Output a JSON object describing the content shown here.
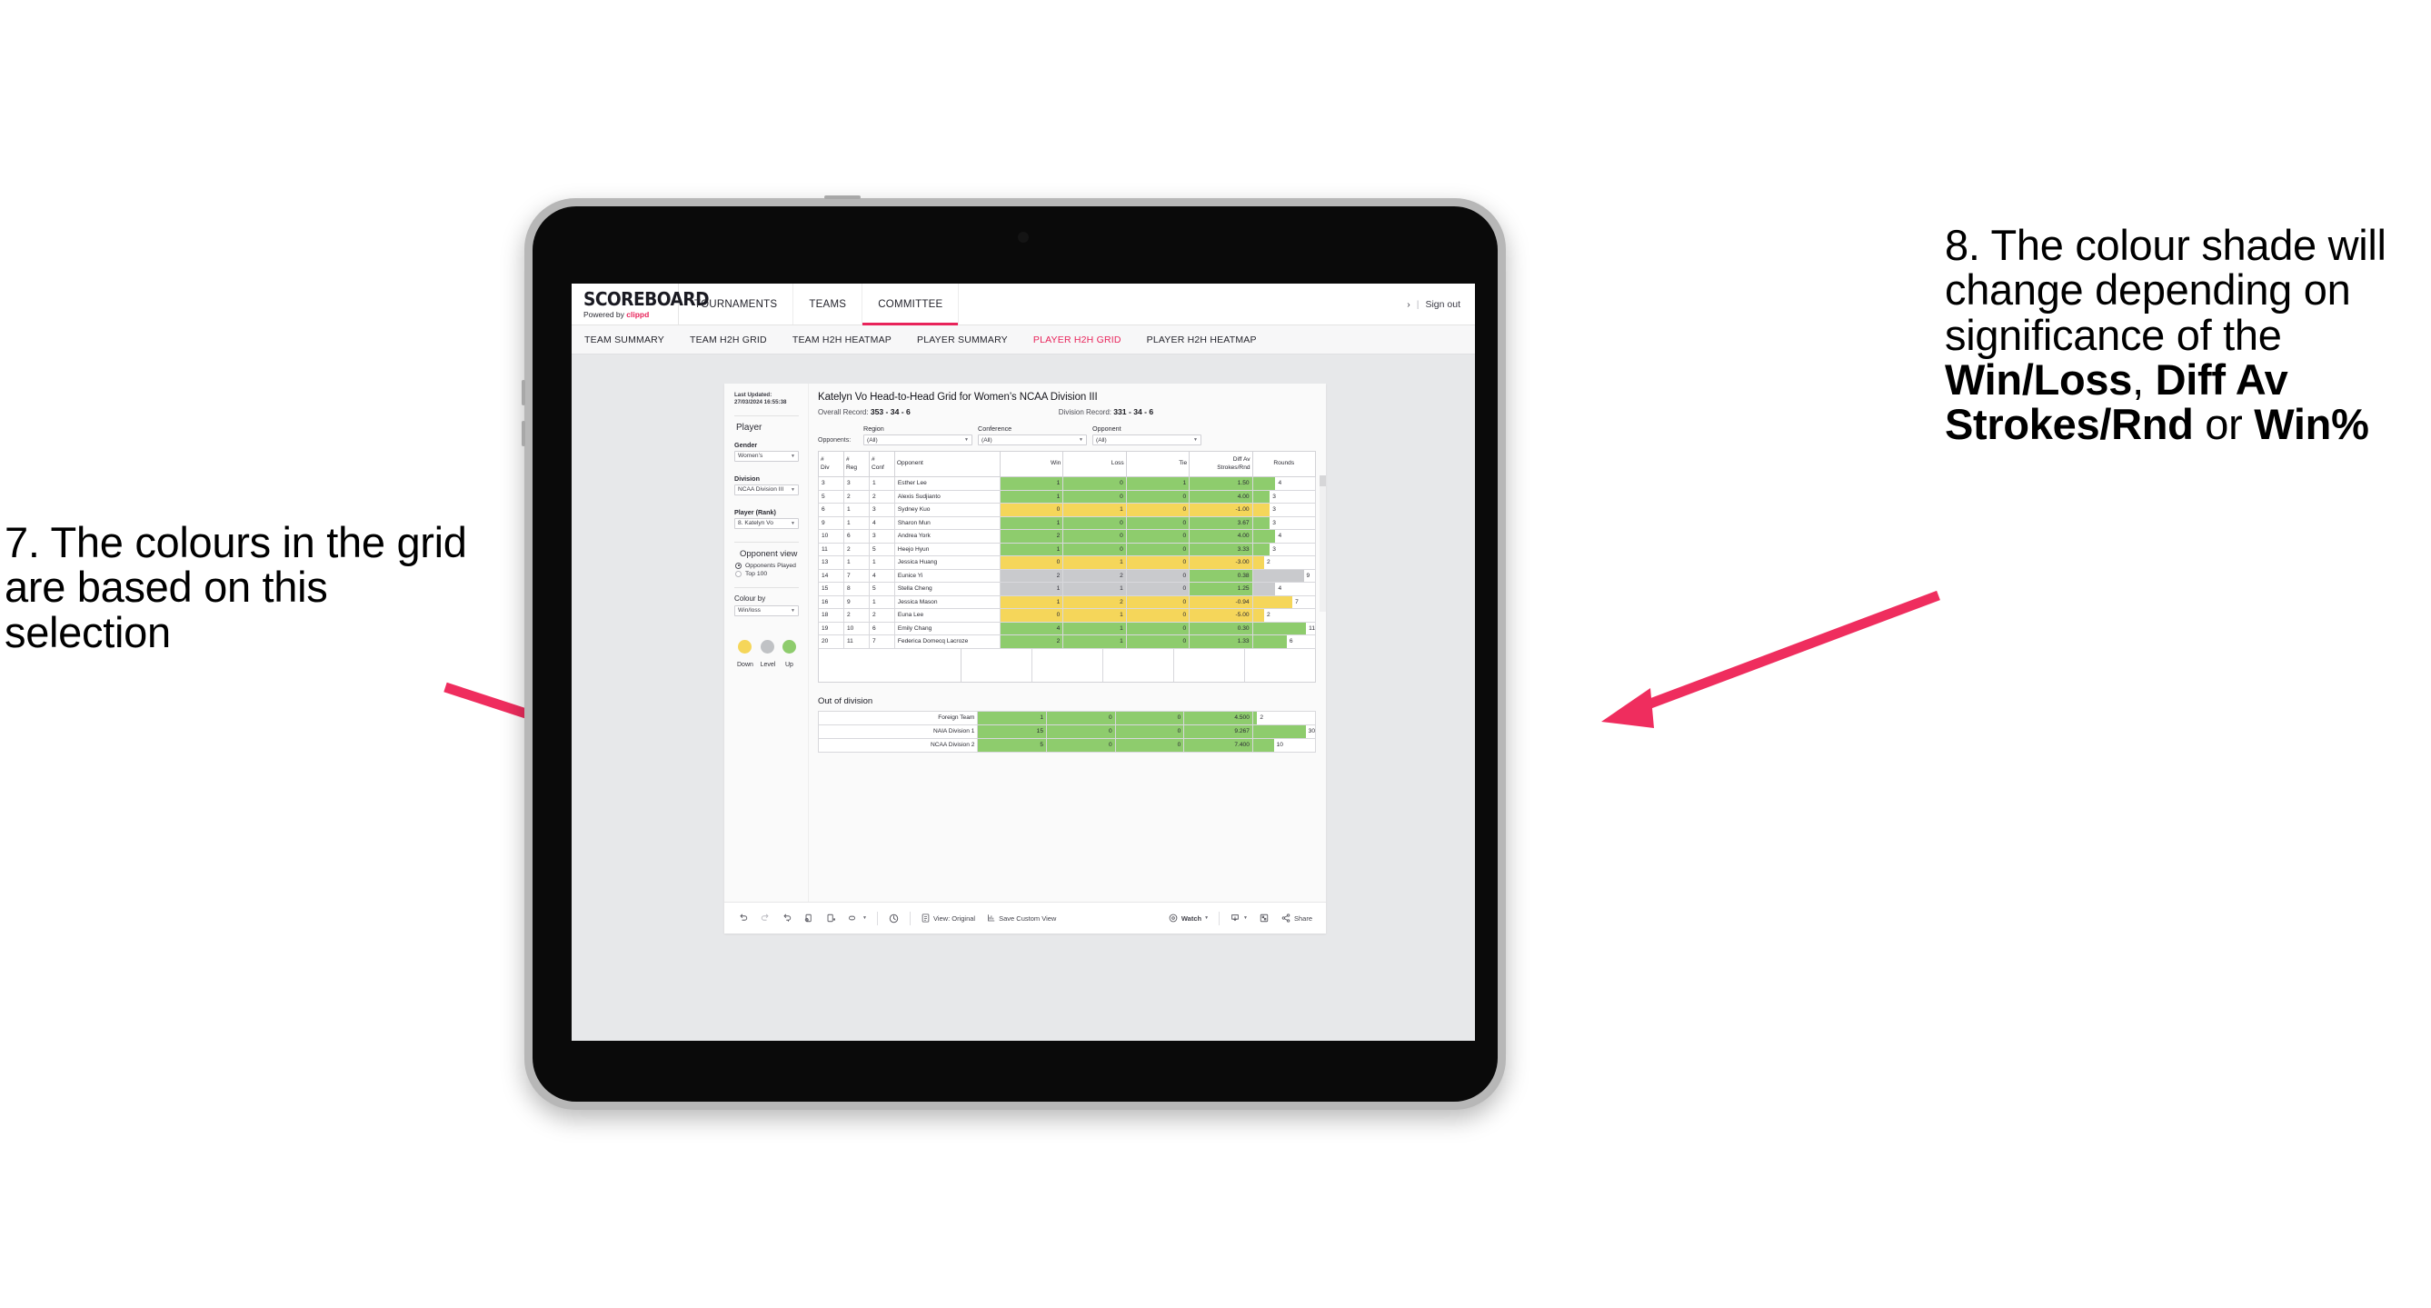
{
  "annotations": {
    "left": "7. The colours in the grid are based on this selection",
    "right_parts": [
      {
        "t": "8. The colour shade will change depending on significance of the ",
        "b": false
      },
      {
        "t": "Win/Loss",
        "b": true
      },
      {
        "t": ", ",
        "b": false
      },
      {
        "t": "Diff Av Strokes/Rnd",
        "b": true
      },
      {
        "t": " or ",
        "b": false
      },
      {
        "t": "Win%",
        "b": true
      }
    ],
    "arrow_color": "#ef2d5e"
  },
  "app": {
    "logo_main": "SCOREBOARD",
    "logo_sub_prefix": "Powered by ",
    "logo_sub_brand": "clippd",
    "top_nav": [
      {
        "label": "TOURNAMENTS",
        "active": false
      },
      {
        "label": "TEAMS",
        "active": false
      },
      {
        "label": "COMMITTEE",
        "active": true
      }
    ],
    "header_right": {
      "chevron": "›",
      "separator": "|",
      "sign_out": "Sign out"
    },
    "sub_nav": [
      {
        "label": "TEAM SUMMARY",
        "active": false
      },
      {
        "label": "TEAM H2H GRID",
        "active": false
      },
      {
        "label": "TEAM H2H HEATMAP",
        "active": false
      },
      {
        "label": "PLAYER SUMMARY",
        "active": false
      },
      {
        "label": "PLAYER H2H GRID",
        "active": true
      },
      {
        "label": "PLAYER H2H HEATMAP",
        "active": false
      }
    ],
    "accent": "#e8235a"
  },
  "sidebar": {
    "last_updated": "Last Updated: 27/03/2024 16:55:38",
    "heading": "Player",
    "fields": [
      {
        "label": "Gender",
        "value": "Women’s"
      },
      {
        "label": "Division",
        "value": "NCAA Division III"
      },
      {
        "label": "Player (Rank)",
        "value": "8. Katelyn Vo"
      }
    ],
    "opponent_view": {
      "heading": "Opponent view",
      "options": [
        {
          "label": "Opponents Played",
          "selected": true
        },
        {
          "label": "Top 100",
          "selected": false
        }
      ]
    },
    "colour_by": {
      "label": "Colour by",
      "value": "Win/loss"
    },
    "legend": [
      {
        "label": "Down",
        "color": "#f5d65a"
      },
      {
        "label": "Level",
        "color": "#c0c2c5"
      },
      {
        "label": "Up",
        "color": "#8ecc6d"
      }
    ]
  },
  "viz": {
    "title": "Katelyn Vo Head-to-Head Grid for Women’s NCAA Division III",
    "overall_record_label": "Overall Record:",
    "overall_record_value": "353 - 34 - 6",
    "division_record_label": "Division Record:",
    "division_record_value": "331 - 34 - 6",
    "opponents_label": "Opponents:",
    "filters": [
      {
        "label": "Region",
        "value": "(All)"
      },
      {
        "label": "Conference",
        "value": "(All)"
      },
      {
        "label": "Opponent",
        "value": "(All)"
      }
    ],
    "out_of_division_title": "Out of division"
  },
  "chart_data": {
    "type": "table",
    "title": "Katelyn Vo Head-to-Head Grid for Women’s NCAA Division III",
    "columns": [
      "# Div",
      "# Reg",
      "# Conf",
      "Opponent",
      "Win",
      "Loss",
      "Tie",
      "Diff Av Strokes/Rnd",
      "Rounds"
    ],
    "column_headers_multiline": [
      [
        "#",
        "Div"
      ],
      [
        "#",
        "Reg"
      ],
      [
        "#",
        "Conf"
      ],
      [
        "Opponent"
      ],
      [
        "Win"
      ],
      [
        "Loss"
      ],
      [
        "Tie"
      ],
      [
        "Diff Av",
        "Strokes/Rnd"
      ],
      [
        "Rounds"
      ]
    ],
    "rounds_max": 11,
    "rows": [
      {
        "div": "3",
        "reg": "3",
        "conf": "1",
        "opponent": "Esther Lee",
        "win": "1",
        "loss": "0",
        "tie": "1",
        "diff": "1.50",
        "rounds": 4,
        "shade": "up"
      },
      {
        "div": "5",
        "reg": "2",
        "conf": "2",
        "opponent": "Alexis Sudjianto",
        "win": "1",
        "loss": "0",
        "tie": "0",
        "diff": "4.00",
        "rounds": 3,
        "shade": "up"
      },
      {
        "div": "6",
        "reg": "1",
        "conf": "3",
        "opponent": "Sydney Kuo",
        "win": "0",
        "loss": "1",
        "tie": "0",
        "diff": "-1.00",
        "rounds": 3,
        "shade": "down"
      },
      {
        "div": "9",
        "reg": "1",
        "conf": "4",
        "opponent": "Sharon Mun",
        "win": "1",
        "loss": "0",
        "tie": "0",
        "diff": "3.67",
        "rounds": 3,
        "shade": "up"
      },
      {
        "div": "10",
        "reg": "6",
        "conf": "3",
        "opponent": "Andrea York",
        "win": "2",
        "loss": "0",
        "tie": "0",
        "diff": "4.00",
        "rounds": 4,
        "shade": "up"
      },
      {
        "div": "11",
        "reg": "2",
        "conf": "5",
        "opponent": "Heejo Hyun",
        "win": "1",
        "loss": "0",
        "tie": "0",
        "diff": "3.33",
        "rounds": 3,
        "shade": "up"
      },
      {
        "div": "13",
        "reg": "1",
        "conf": "1",
        "opponent": "Jessica Huang",
        "win": "0",
        "loss": "1",
        "tie": "0",
        "diff": "-3.00",
        "rounds": 2,
        "shade": "down"
      },
      {
        "div": "14",
        "reg": "7",
        "conf": "4",
        "opponent": "Eunice Yi",
        "win": "2",
        "loss": "2",
        "tie": "0",
        "diff": "0.38",
        "rounds": 9,
        "shade": "level",
        "diff_shade": "up"
      },
      {
        "div": "15",
        "reg": "8",
        "conf": "5",
        "opponent": "Stella Cheng",
        "win": "1",
        "loss": "1",
        "tie": "0",
        "diff": "1.25",
        "rounds": 4,
        "shade": "level",
        "diff_shade": "up"
      },
      {
        "div": "16",
        "reg": "9",
        "conf": "1",
        "opponent": "Jessica Mason",
        "win": "1",
        "loss": "2",
        "tie": "0",
        "diff": "-0.94",
        "rounds": 7,
        "shade": "down"
      },
      {
        "div": "18",
        "reg": "2",
        "conf": "2",
        "opponent": "Euna Lee",
        "win": "0",
        "loss": "1",
        "tie": "0",
        "diff": "-5.00",
        "rounds": 2,
        "shade": "down"
      },
      {
        "div": "19",
        "reg": "10",
        "conf": "6",
        "opponent": "Emily Chang",
        "win": "4",
        "loss": "1",
        "tie": "0",
        "diff": "0.30",
        "rounds": 11,
        "shade": "up"
      },
      {
        "div": "20",
        "reg": "11",
        "conf": "7",
        "opponent": "Federica Domecq Lacroze",
        "win": "2",
        "loss": "1",
        "tie": "0",
        "diff": "1.33",
        "rounds": 6,
        "shade": "up"
      }
    ],
    "out_of_division": {
      "rounds_max": 30,
      "rows": [
        {
          "name": "Foreign Team",
          "win": "1",
          "loss": "0",
          "tie": "0",
          "diff": "4.500",
          "rounds": 2,
          "shade": "up"
        },
        {
          "name": "NAIA Division 1",
          "win": "15",
          "loss": "0",
          "tie": "0",
          "diff": "9.267",
          "rounds": 30,
          "shade": "up"
        },
        {
          "name": "NCAA Division 2",
          "win": "5",
          "loss": "0",
          "tie": "0",
          "diff": "7.400",
          "rounds": 10,
          "shade": "up"
        }
      ]
    },
    "shade_colors": {
      "up": "#8ecc6d",
      "down": "#f5d65a",
      "level": "#c9cacd"
    }
  },
  "toolbar": {
    "items": [
      {
        "name": "undo-icon",
        "label": ""
      },
      {
        "name": "redo-icon",
        "label": ""
      },
      {
        "name": "revert-icon",
        "label": ""
      },
      {
        "name": "refresh-data-icon",
        "label": ""
      },
      {
        "name": "pause-updates-icon",
        "label": ""
      },
      {
        "name": "highlight-icon",
        "label": ""
      },
      {
        "name": "alerts-icon",
        "label": ""
      },
      {
        "name": "view-original-icon",
        "label": "View: Original"
      },
      {
        "name": "save-custom-view-icon",
        "label": "Save Custom View"
      },
      {
        "name": "watch-icon",
        "label": "Watch"
      },
      {
        "name": "download-icon",
        "label": ""
      },
      {
        "name": "fullscreen-icon",
        "label": ""
      },
      {
        "name": "share-icon",
        "label": "Share"
      }
    ],
    "view_original": "View: Original",
    "save_custom_view": "Save Custom View",
    "watch": "Watch",
    "share": "Share"
  }
}
